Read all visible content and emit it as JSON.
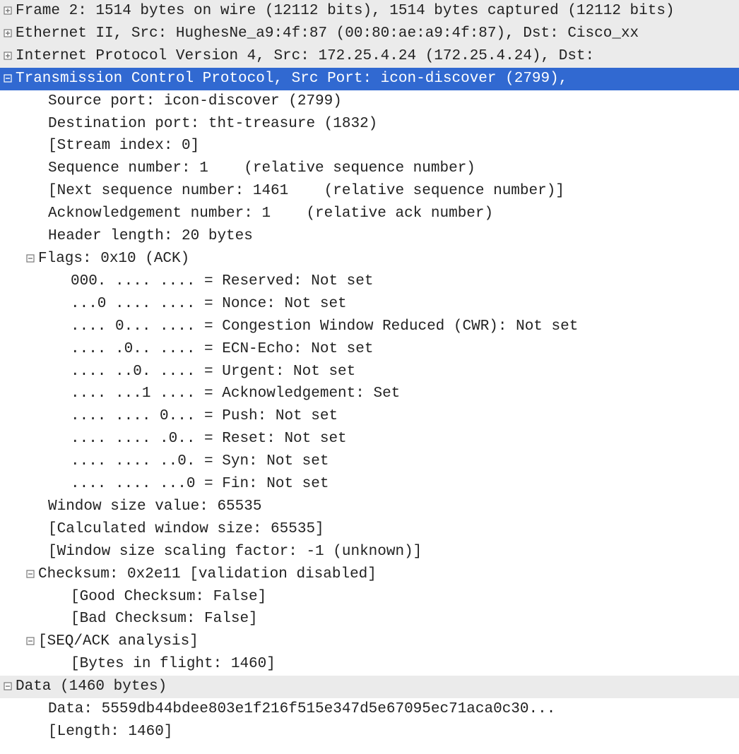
{
  "tree": {
    "frame": "Frame 2: 1514 bytes on wire (12112 bits), 1514 bytes captured (12112 bits)",
    "eth": "Ethernet II, Src: HughesNe_a9:4f:87 (00:80:ae:a9:4f:87), Dst: Cisco_xx",
    "ip": "Internet Protocol Version 4, Src: 172.25.4.24 (172.25.4.24), Dst: ",
    "tcp": "Transmission Control Protocol, Src Port: icon-discover (2799),",
    "src_port": "Source port: icon-discover (2799)",
    "dst_port": "Destination port: tht-treasure (1832)",
    "stream": "[Stream index: 0]",
    "seq": "Sequence number: 1    (relative sequence number)",
    "next_seq": "[Next sequence number: 1461    (relative sequence number)]",
    "ack": "Acknowledgement number: 1    (relative ack number)",
    "hdr_len": "Header length: 20 bytes",
    "flags": "Flags: 0x10 (ACK)",
    "f_reserved": "000. .... .... = Reserved: Not set",
    "f_nonce": "...0 .... .... = Nonce: Not set",
    "f_cwr": ".... 0... .... = Congestion Window Reduced (CWR): Not set",
    "f_ecn": ".... .0.. .... = ECN-Echo: Not set",
    "f_urg": ".... ..0. .... = Urgent: Not set",
    "f_ack": ".... ...1 .... = Acknowledgement: Set",
    "f_push": ".... .... 0... = Push: Not set",
    "f_reset": ".... .... .0.. = Reset: Not set",
    "f_syn": ".... .... ..0. = Syn: Not set",
    "f_fin": ".... .... ...0 = Fin: Not set",
    "win_size": "Window size value: 65535",
    "calc_win": "[Calculated window size: 65535]",
    "win_scale": "[Window size scaling factor: -1 (unknown)]",
    "checksum": "Checksum: 0x2e11 [validation disabled]",
    "good_ck": "[Good Checksum: False]",
    "bad_ck": "[Bad Checksum: False]",
    "seqack": "[SEQ/ACK analysis]",
    "bytes_fl": "[Bytes in flight: 1460]",
    "data_hdr": "Data (1460 bytes)",
    "data_val": "Data: 5559db44bdee803e1f216f515e347d5e67095ec71aca0c30...",
    "data_len": "[Length: 1460]"
  }
}
